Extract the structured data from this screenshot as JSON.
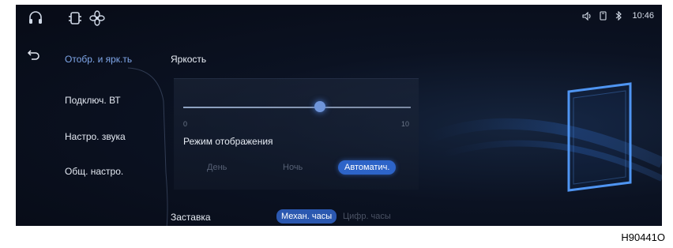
{
  "topbar": {
    "icons": [
      "headphones-icon",
      "car-settings-icon",
      "fan-icon"
    ],
    "status": {
      "time": "10:46",
      "icons": [
        "volume-icon",
        "phone-icon",
        "bluetooth-icon"
      ]
    }
  },
  "sidebar": {
    "items": [
      {
        "label": "Отобр. и ярк.ть",
        "active": true
      },
      {
        "label": "Подключ. ВТ",
        "active": false
      },
      {
        "label": "Настро. звука",
        "active": false
      },
      {
        "label": "Общ. настро.",
        "active": false
      }
    ]
  },
  "brightness": {
    "title": "Яркость",
    "min": "0",
    "max": "10",
    "value": 6
  },
  "display_mode": {
    "title": "Режим отображения",
    "options": [
      "День",
      "Ночь",
      "Автоматич."
    ],
    "selected": "Автоматич."
  },
  "screensaver": {
    "title": "Заставка",
    "options": [
      "Механ. часы",
      "Цифр. часы"
    ],
    "selected": "Механ. часы"
  },
  "figure_label": "H90441O",
  "colors": {
    "accent": "#2d64c8",
    "background": "#070b16",
    "active_text": "#7fa6e8"
  }
}
